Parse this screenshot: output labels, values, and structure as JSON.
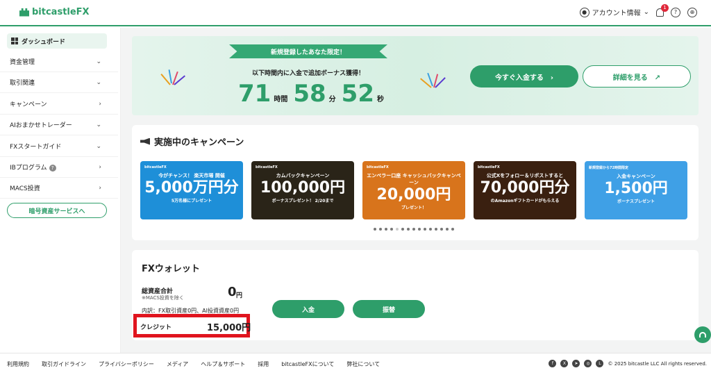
{
  "header": {
    "brand": "bitcastleFX",
    "account_label": "アカウント情報",
    "notification_count": "1"
  },
  "sidebar": {
    "dashboard": "ダッシュボード",
    "items": [
      {
        "label": "資金管理",
        "chevron": "⌄"
      },
      {
        "label": "取引関連",
        "chevron": "⌄"
      },
      {
        "label": "キャンペーン",
        "chevron": "›"
      },
      {
        "label": "AIおまかせトレーダー",
        "chevron": "⌄"
      },
      {
        "label": "FXスタートガイド",
        "chevron": "⌄"
      },
      {
        "label": "IBプログラム",
        "chevron": "›"
      },
      {
        "label": "MACS投資",
        "chevron": "›"
      }
    ],
    "crypto_button": "暗号資産サービスへ"
  },
  "banner": {
    "ribbon": "新規登録したあなた限定！",
    "subtitle": "以下時間内に入金で追加ボーナス獲得！",
    "hours": "71",
    "hours_unit": "時間",
    "minutes": "58",
    "minutes_unit": "分",
    "seconds": "52",
    "seconds_unit": "秒",
    "deposit_now": "今すぐ入金する　›",
    "details": "詳細を見る　↗"
  },
  "campaigns": {
    "title": "実施中のキャンペーン",
    "cards": [
      {
        "logo": "bitcastleFX",
        "head": "今がチャンス！ 楽天市場 開催",
        "big": "5,000万円分",
        "sub": "5万名様にプレゼント",
        "color": "#1e8fd8"
      },
      {
        "logo": "bitcastleFX",
        "head": "カムバックキャンペーン",
        "big": "100,000円",
        "sub": "ボーナスプレゼント！ 2/20まで",
        "color": "#2a2418"
      },
      {
        "logo": "bitcastleFX",
        "head": "エンペラー口座 キャッシュバックキャンペーン",
        "big": "20,000円",
        "sub": "プレゼント！",
        "color": "#d8741c"
      },
      {
        "logo": "bitcastleFX",
        "head": "公式Xをフォロー＆リポストすると",
        "big": "70,000円分",
        "sub": "のAmazonギフトカードがもらえる",
        "color": "#3a2010"
      },
      {
        "logo": "新規登録から72時間限定",
        "head": "入金キャンペーン",
        "big": "1,500円",
        "sub": "ボーナスプレゼント",
        "color": "#3fa0e6"
      }
    ],
    "dot_count": 15,
    "active_dot": 4
  },
  "wallet": {
    "title": "FXウォレット",
    "total_label": "総資産合計",
    "total_note": "※MACS投資を除く",
    "total_value": "0",
    "total_unit": "円",
    "breakdown": "内訳：FX取引資産0円、AI投資資産0円",
    "credit_label": "クレジット",
    "credit_value": "15,000円",
    "deposit_button": "入金",
    "transfer_button": "振替"
  },
  "footer": {
    "links": [
      "利用規約",
      "取引ガイドライン",
      "プライバシーポリシー",
      "メディア",
      "ヘルプ＆サポート",
      "採用",
      "bitcastleFXについて",
      "弊社について"
    ],
    "copyright": "© 2025 bitcastle LLC All rights reserved."
  },
  "colors": {
    "accent": "#2e9e6a",
    "highlight_border": "#e0141e",
    "notification": "#e0283a"
  }
}
